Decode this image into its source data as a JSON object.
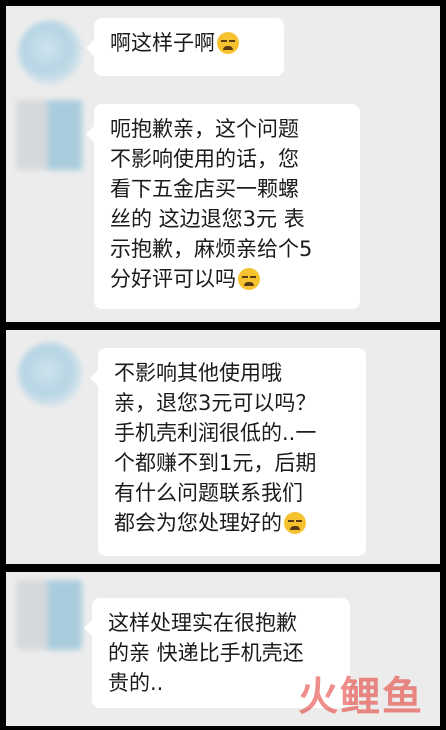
{
  "messages": [
    {
      "text": "啊这样子啊"
    },
    {
      "text": "呃抱歉亲，这个问题\n不影响使用的话，您\n看下五金店买一颗螺\n丝的 这边退您3元 表\n示抱歉，麻烦亲给个5\n分好评可以吗"
    },
    {
      "text": "不影响其他使用哦\n亲，退您3元可以吗？\n手机壳利润很低的..一\n个都赚不到1元，后期\n有什么问题联系我们\n都会为您处理好的"
    },
    {
      "text": "这样处理实在很抱歉\n的亲 快递比手机壳还\n贵的.."
    }
  ],
  "icons": {
    "msg0": "tired-face-emoji-icon",
    "msg1": "crying-face-emoji-icon",
    "msg2": "crying-face-emoji-icon"
  },
  "watermark": {
    "text": "火鲤鱼"
  }
}
